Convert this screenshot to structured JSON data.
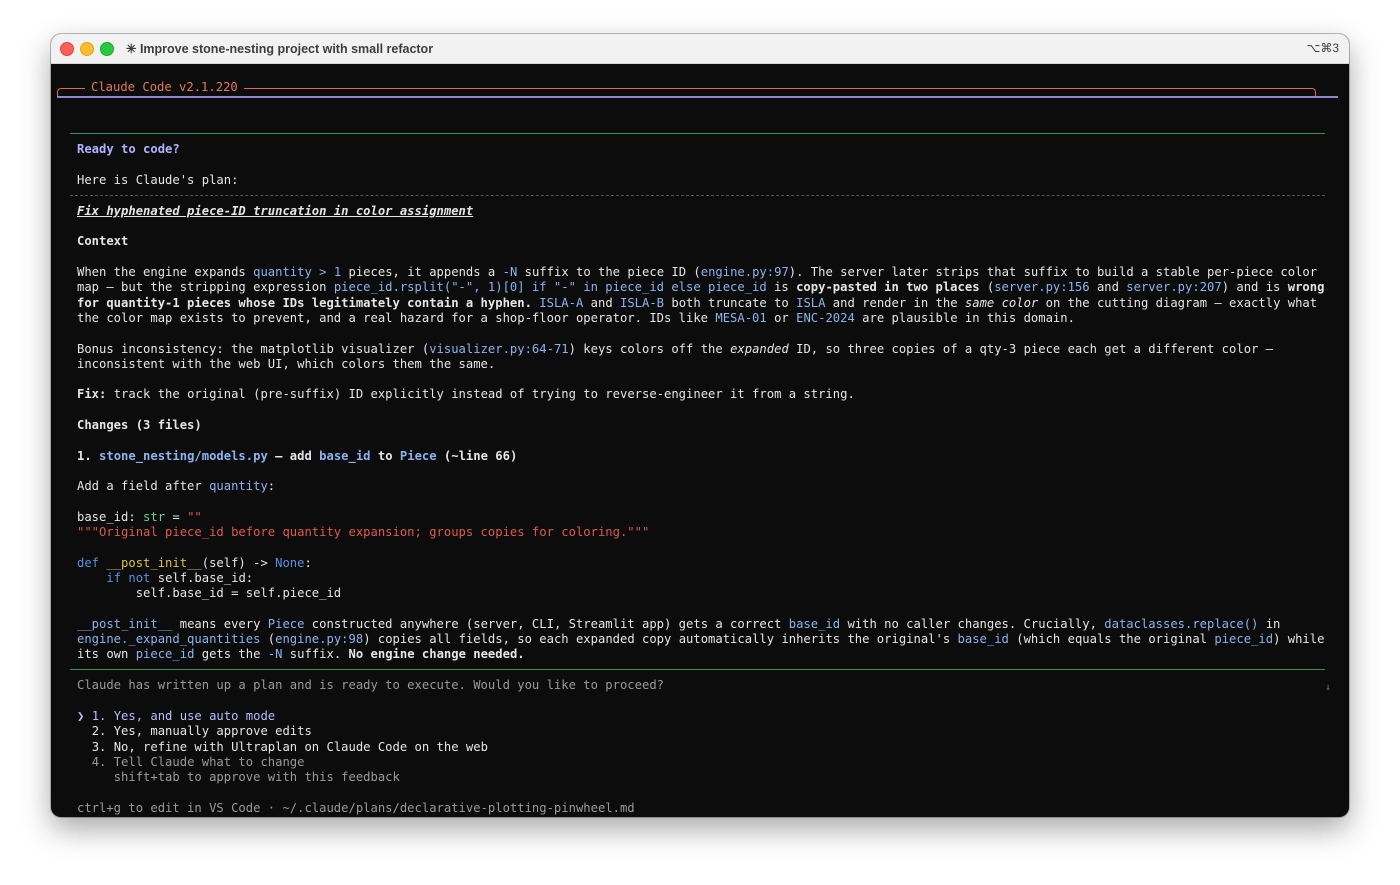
{
  "window": {
    "title": "✳ Improve stone-nesting project with small refactor",
    "shortcut": "⌥⌘3"
  },
  "header": {
    "label": "Claude Code v2.1.220"
  },
  "plan": {
    "ready": "Ready to code?",
    "intro": "Here is Claude's plan:",
    "heading": "Fix hyphenated piece-ID truncation in color assignment",
    "context_heading": "Context",
    "ctx": {
      "l1a": "When the engine expands ",
      "l1b": "quantity > 1",
      "l1c": " pieces, it appends a ",
      "l1d": "-N",
      "l1e": " suffix to the piece ID (",
      "l1f": "engine.py:97",
      "l1g": "). The server later strips that suffix to build a stable per-piece color",
      "l2a": "map — but the stripping expression ",
      "l2b": "piece_id.rsplit(\"-\", 1)[0] if \"-\" in piece_id else piece_id",
      "l2c": " is ",
      "l2d": "copy-pasted in two places",
      "l2e": " (",
      "l2f": "server.py:156",
      "l2g": " and ",
      "l2h": "server.py:207",
      "l2i": ") and is ",
      "l2j": "wrong",
      "l3a": "for quantity-1 pieces whose IDs legitimately contain a hyphen.",
      "l3b": " ",
      "l3c": "ISLA-A",
      "l3d": " and ",
      "l3e": "ISLA-B",
      "l3f": " both truncate to ",
      "l3g": "ISLA",
      "l3h": " and render in the ",
      "l3i": "same color",
      "l3j": " on the cutting diagram — exactly what",
      "l4a": "the color map exists to prevent, and a real hazard for a shop-floor operator. IDs like ",
      "l4b": "MESA-01",
      "l4c": " or ",
      "l4d": "ENC-2024",
      "l4e": " are plausible in this domain."
    },
    "bonus": {
      "a": "Bonus inconsistency: the matplotlib visualizer (",
      "b": "visualizer.py:64-71",
      "c": ") keys colors off the ",
      "d": "expanded",
      "e": " ID, so three copies of a qty-3 piece each get a different color —",
      "f": "inconsistent with the web UI, which colors them the same."
    },
    "fix": {
      "label": "Fix:",
      "text": " track the original (pre-suffix) ID explicitly instead of trying to reverse-engineer it from a string."
    },
    "changes_heading": "Changes (3 files)",
    "change1": {
      "num": "1. ",
      "file": "stone_nesting/models.py",
      "mid": " — add ",
      "field": "base_id",
      "to": " to ",
      "cls": "Piece",
      "tail": " (~line 66)"
    },
    "addfield": {
      "a": "Add a field after ",
      "b": "quantity",
      "c": ":"
    },
    "code": {
      "c1a": "base_id: ",
      "c1b": "str",
      "c1c": " = ",
      "c1d": "\"\"",
      "c2": "\"\"\"Original piece_id before quantity expansion; groups copies for coloring.\"\"\"",
      "c4a": "def",
      "c4b": " ",
      "c4c": "__post_init__",
      "c4d": "(self) -> ",
      "c4e": "None",
      "c4f": ":",
      "c5a": "    ",
      "c5b": "if not",
      "c5c": " self.base_id:",
      "c6": "        self.base_id = self.piece_id"
    },
    "post": {
      "l1a": "__post_init__",
      "l1b": " means every ",
      "l1c": "Piece",
      "l1d": " constructed anywhere (server, CLI, Streamlit app) gets a correct ",
      "l1e": "base_id",
      "l1f": " with no caller changes. Crucially, ",
      "l1g": "dataclasses.replace()",
      "l1h": " in",
      "l2a": "engine._expand_quantities",
      "l2b": " (",
      "l2c": "engine.py:98",
      "l2d": ") copies all fields, so each expanded copy automatically inherits the original's ",
      "l2e": "base_id",
      "l2f": " (which equals the original ",
      "l2g": "piece_id",
      "l2h": ") while",
      "l3a": "its own ",
      "l3b": "piece_id",
      "l3c": " gets the ",
      "l3d": "-N",
      "l3e": " suffix. ",
      "l3f": "No engine change needed."
    },
    "scroll_indicator": "↓"
  },
  "prompt": {
    "question": "Claude has written up a plan and is ready to execute. Would you like to proceed?",
    "pointer": "❯",
    "options": [
      "1. Yes, and use auto mode",
      "2. Yes, manually approve edits",
      "3. No, refine with Ultraplan on Claude Code on the web",
      "4. Tell Claude what to change"
    ],
    "hint": "shift+tab to approve with this feedback",
    "footer": "ctrl+g to edit in VS Code · ~/.claude/plans/declarative-plotting-pinwheel.md"
  }
}
